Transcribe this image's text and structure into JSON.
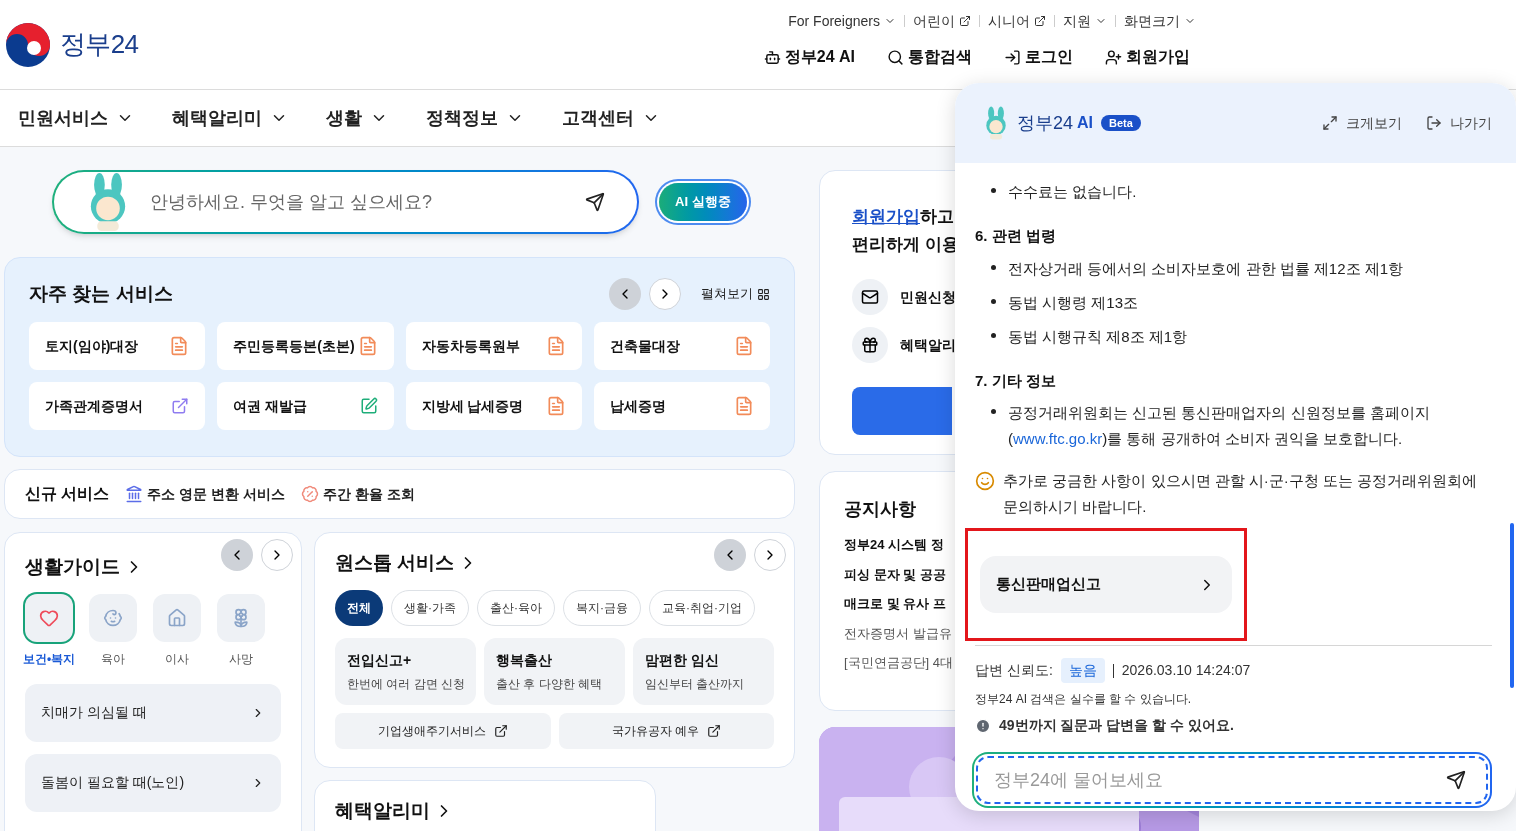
{
  "header": {
    "logo_text": "정부24",
    "util_links": [
      {
        "label": "For Foreigners",
        "kind": "dropdown"
      },
      {
        "label": "어린이",
        "kind": "external"
      },
      {
        "label": "시니어",
        "kind": "external"
      },
      {
        "label": "지원",
        "kind": "dropdown"
      },
      {
        "label": "화면크기",
        "kind": "dropdown"
      }
    ],
    "actions": [
      {
        "label": "정부24 AI",
        "kind": "ai"
      },
      {
        "label": "통합검색",
        "kind": "search"
      },
      {
        "label": "로그인",
        "kind": "login"
      },
      {
        "label": "회원가입",
        "kind": "signup"
      }
    ]
  },
  "nav": [
    "민원서비스",
    "혜택알리미",
    "생활",
    "정책정보",
    "고객센터"
  ],
  "ai_search": {
    "placeholder": "안녕하세요. 무엇을 알고 싶으세요?",
    "status": "AI 실행중"
  },
  "frequent": {
    "title": "자주 찾는 서비스",
    "expand": "펼쳐보기",
    "items": [
      {
        "label": "토지(임야)대장",
        "kind": "pdf"
      },
      {
        "label": "주민등록등본(초본)",
        "kind": "pdf"
      },
      {
        "label": "자동차등록원부",
        "kind": "pdf"
      },
      {
        "label": "건축물대장",
        "kind": "pdf"
      },
      {
        "label": "가족관계증명서",
        "kind": "external"
      },
      {
        "label": "여권 재발급",
        "kind": "edit"
      },
      {
        "label": "지방세 납세증명",
        "kind": "pdf"
      },
      {
        "label": "납세증명",
        "kind": "pdf"
      }
    ]
  },
  "new_services": {
    "title": "신규 서비스",
    "items": [
      {
        "label": "주소 영문 변환 서비스",
        "kind": "address"
      },
      {
        "label": "주간 환율 조회",
        "kind": "exchange"
      }
    ]
  },
  "life_guide": {
    "title": "생활가이드",
    "categories": [
      {
        "label": "보건•복지",
        "kind": "health",
        "selected": true
      },
      {
        "label": "육아",
        "kind": "baby",
        "selected": false
      },
      {
        "label": "이사",
        "kind": "move",
        "selected": false
      },
      {
        "label": "사망",
        "kind": "death",
        "selected": false
      }
    ],
    "items": [
      "치매가 의심될 때",
      "돌봄이 필요할 때(노인)"
    ]
  },
  "onestop": {
    "title": "원스톱 서비스",
    "filters": [
      {
        "label": "전체",
        "selected": true
      },
      {
        "label": "생활·가족",
        "selected": false
      },
      {
        "label": "출산·육아",
        "selected": false
      },
      {
        "label": "복지·금융",
        "selected": false
      },
      {
        "label": "교육·취업·기업",
        "selected": false
      }
    ],
    "cards": [
      {
        "title": "전입신고+",
        "subtitle": "한번에 여러 감면 신청"
      },
      {
        "title": "행복출산",
        "subtitle": "출산 후 다양한 혜택"
      },
      {
        "title": "맘편한 임신",
        "subtitle": "임신부터 출산까지"
      }
    ],
    "links": [
      "기업생애주기서비스",
      "국가유공자 예우"
    ]
  },
  "benefits": {
    "title": "혜택알리미"
  },
  "signup_card": {
    "link": "회원가입",
    "after": "하고",
    "line2": "편리하게 이용",
    "features": [
      {
        "label": "민원신청",
        "kind": "mail"
      },
      {
        "label": "혜택알리",
        "kind": "gift"
      }
    ]
  },
  "notices": {
    "title": "공지사항",
    "items": [
      {
        "text": "정부24 시스템 정",
        "bold": true
      },
      {
        "text": "피싱 문자 및 공공",
        "bold": true
      },
      {
        "text": "매크로 및 유사 프",
        "bold": true
      },
      {
        "text": "전자증명서 발급유",
        "bold": false
      },
      {
        "text": "[국민연금공단] 4대",
        "bold": false
      }
    ]
  },
  "chat": {
    "title": "정부24",
    "ai": "AI",
    "badge": "Beta",
    "actions": [
      {
        "label": "크게보기",
        "kind": "expand"
      },
      {
        "label": "나가기",
        "kind": "exit"
      }
    ],
    "blocks": [
      {
        "kind": "bullet",
        "text": "수수료는 없습니다."
      },
      {
        "kind": "heading",
        "text": "6. 관련 법령"
      },
      {
        "kind": "bullet",
        "text": "전자상거래 등에서의 소비자보호에 관한 법률 제12조 제1항"
      },
      {
        "kind": "bullet",
        "text": "동법 시행령 제13조"
      },
      {
        "kind": "bullet",
        "text": "동법 시행규칙 제8조 제1항"
      },
      {
        "kind": "heading",
        "text": "7. 기타 정보"
      },
      {
        "kind": "bullet",
        "text": "공정거래위원회는 신고된 통신판매업자의 신원정보를 홈페이지(",
        "link": "www.ftc.go.kr",
        "after": ")를 통해 공개하여 소비자 권익을 보호합니다."
      },
      {
        "kind": "note",
        "text": "추가로 궁금한 사항이 있으시면 관할 시·군·구청 또는 공정거래위원회에 문의하시기 바랍니다."
      }
    ],
    "action_button": {
      "label": "통신판매업신고",
      "highlighted": true
    },
    "confidence_label": "답변 신뢰도:",
    "confidence": "높음",
    "timestamp": "2026.03.10 14:24:07",
    "disclaimer": "정부24 AI 검색은 실수를 할 수 있습니다.",
    "limit": "49번까지 질문과 답변을 할 수 있어요.",
    "input": {
      "placeholder": "정부24에 물어보세요"
    }
  }
}
